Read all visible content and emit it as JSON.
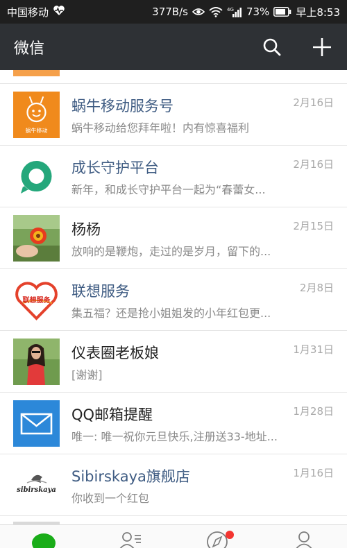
{
  "status_bar": {
    "carrier": "中国移动",
    "network_speed": "377B/s",
    "battery": "73%",
    "time": "早上8:53",
    "signal_type": "4G"
  },
  "app": {
    "title": "微信",
    "actions": [
      "search-icon",
      "plus-icon"
    ]
  },
  "conversations": [
    {
      "name": "蜗牛移动服务号",
      "preview": "蜗牛移动给您拜年啦！内有惊喜福利",
      "date": "2月16日",
      "avatar_text": "蜗牛移动",
      "name_color": "#3e5b82"
    },
    {
      "name": "成长守护平台",
      "preview": "新年，和成长守护平台一起为“春蕾女...",
      "date": "2月16日",
      "name_color": "#3e5b82"
    },
    {
      "name": "杨杨",
      "preview": "放响的是鞭炮，走过的是岁月，留下的...",
      "date": "2月15日",
      "name_color": "#222222"
    },
    {
      "name": "联想服务",
      "preview": "集五福？还是抢小姐姐发的小年红包更...",
      "date": "2月8日",
      "avatar_text": "联想服务",
      "name_color": "#3e5b82"
    },
    {
      "name": "仪表圈老板娘",
      "preview": "[谢谢]",
      "date": "1月31日",
      "name_color": "#222222"
    },
    {
      "name": "QQ邮箱提醒",
      "preview": "唯一: 唯一祝你元旦快乐,注册送33-地址...",
      "date": "1月28日",
      "name_color": "#222222"
    },
    {
      "name": "Sibirskaya旗舰店",
      "preview": "你收到一个红包",
      "date": "1月16日",
      "avatar_text": "sibirskaya",
      "name_color": "#3e5b82"
    }
  ],
  "tabs": [
    {
      "icon": "chat-bubble-icon",
      "active": true
    },
    {
      "icon": "contacts-icon",
      "active": false
    },
    {
      "icon": "discover-compass-icon",
      "active": false,
      "badge": true
    },
    {
      "icon": "me-person-icon",
      "active": false
    }
  ],
  "colors": {
    "header": "#2e3135",
    "status_bar": "#1f1f1f",
    "active_green": "#1aad19",
    "link_name": "#3e5b82",
    "badge_red": "#f43530"
  }
}
